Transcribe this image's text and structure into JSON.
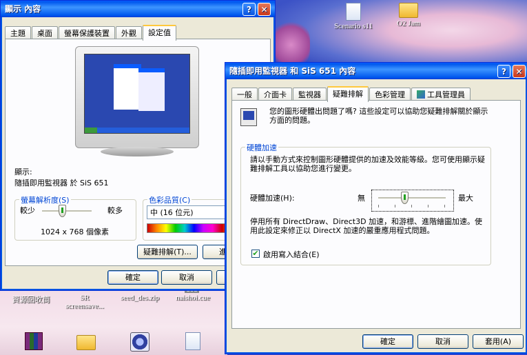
{
  "desktop": {
    "icons": [
      {
        "label": "Scenario s11"
      },
      {
        "label": "O2 Jam"
      },
      {
        "label": "資源回收筒"
      },
      {
        "label": "SR screensave..."
      },
      {
        "label": "seed_des.zip"
      },
      {
        "label": "naishoi.cue"
      }
    ],
    "corner_text": "CUE"
  },
  "back_window": {
    "title": "顯示 內容",
    "help": "?",
    "close": "✕",
    "tabs": [
      "主題",
      "桌面",
      "螢幕保護裝置",
      "外觀",
      "設定值"
    ],
    "display_label": "顯示:",
    "display_value": "隨插即用監視器 於 SiS 651",
    "resolution_group": "螢幕解析度(S)",
    "res_less": "較少",
    "res_more": "較多",
    "res_value": "1024 x 768 個像素",
    "color_group": "色彩品質(C)",
    "color_value": "中 (16 位元)",
    "troubleshoot_button": "疑難排解(T)...",
    "advanced_button_partial": "進",
    "ok": "確定",
    "cancel": "取消"
  },
  "front_window": {
    "title": "隨插即用監視器 和 SiS 651 內容",
    "help": "?",
    "close": "✕",
    "tabs": [
      "一般",
      "介面卡",
      "監視器",
      "疑難排解",
      "色彩管理",
      "工具管理員"
    ],
    "intro_text": "您的圖形硬體出問題了嗎? 這些設定可以協助您疑難排解關於顯示方面的問題。",
    "group_title": "硬體加速",
    "group_desc": "請以手動方式來控制圖形硬體提供的加速及效能等級。您可使用顯示疑難排解工具以協助您進行變更。",
    "accel_label": "硬體加速(H):",
    "accel_min": "無",
    "accel_max": "最大",
    "accel_level_fraction": 0.4,
    "accel_note": "停用所有 DirectDraw、Direct3D 加速，和游標、進階繪圖加速。使用此設定來修正以 DirectX 加速的嚴重應用程式問題。",
    "write_combining": "啟用寫入結合(E)",
    "ok": "確定",
    "cancel": "取消",
    "apply": "套用(A)"
  }
}
